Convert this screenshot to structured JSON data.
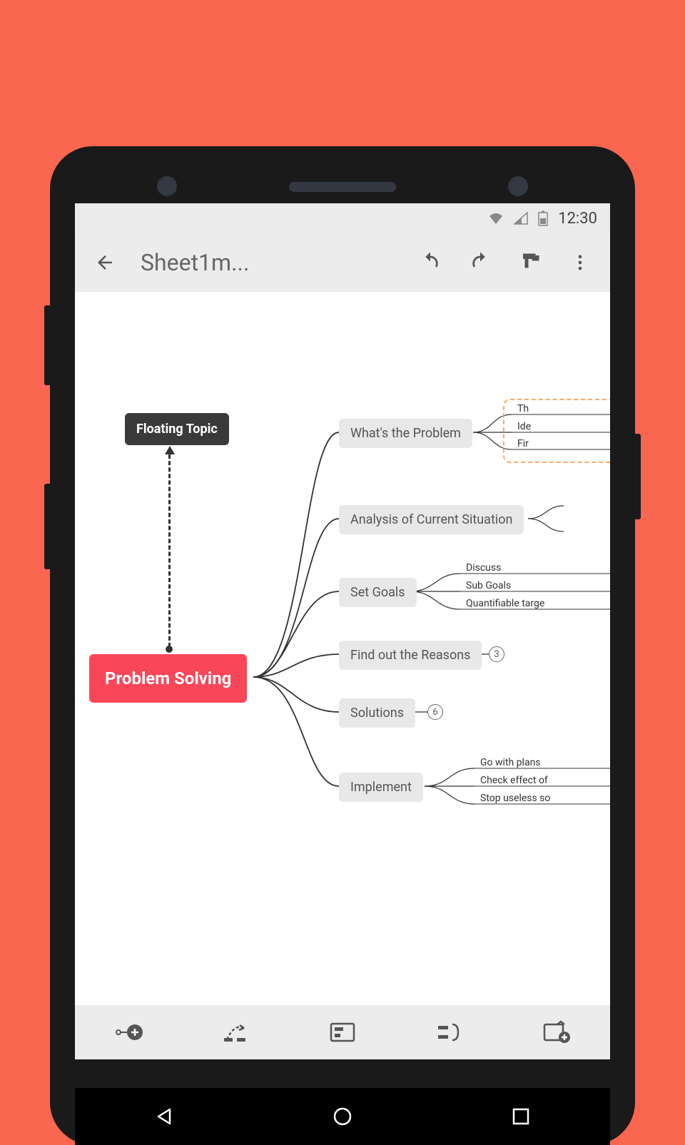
{
  "status_bar": {
    "time": "12:30"
  },
  "app_bar": {
    "title": "Sheet1m..."
  },
  "mindmap": {
    "floating_topic": "Floating Topic",
    "central": "Problem Solving",
    "branches": [
      {
        "label": "What's the Problem",
        "children": [
          "Th",
          "Ide",
          "Fir"
        ]
      },
      {
        "label": "Analysis of Current Situation",
        "children": []
      },
      {
        "label": "Set Goals",
        "children": [
          "Discuss",
          "Sub Goals",
          "Quantifiable targe"
        ]
      },
      {
        "label": "Find out the Reasons",
        "count": "3"
      },
      {
        "label": "Solutions",
        "count": "6"
      },
      {
        "label": "Implement",
        "children": [
          "Go with plans",
          "Check effect of",
          "Stop useless so"
        ]
      }
    ]
  }
}
